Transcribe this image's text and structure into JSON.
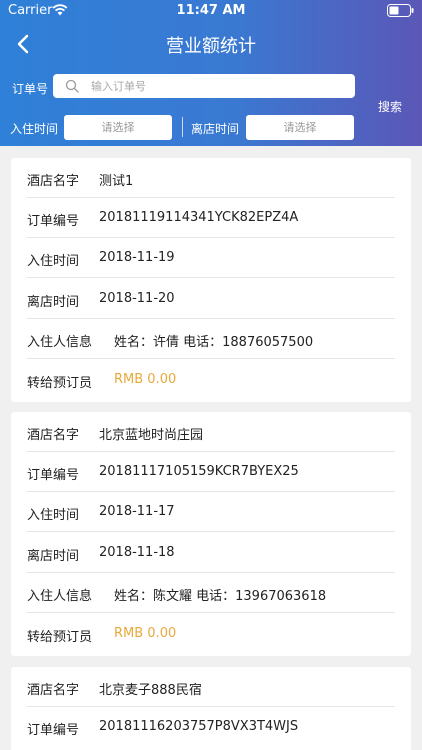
{
  "status": {
    "carrier": "Carrier",
    "time": "11:47 AM"
  },
  "nav": {
    "title": "营业额统计"
  },
  "search": {
    "order_label": "订单号",
    "order_placeholder": "输入订单号",
    "search_label": "搜索",
    "checkin_label": "入住时间",
    "checkout_label": "离店时间",
    "select_placeholder": "请选择"
  },
  "labels": {
    "hotel": "酒店名字",
    "order_no": "订单编号",
    "checkin": "入住时间",
    "checkout": "离店时间",
    "guest": "入住人信息",
    "transfer": "转给预订员"
  },
  "orders": [
    {
      "hotel": "测试1",
      "order_no": "20181119114341YCK82EPZ4A",
      "checkin": "2018-11-19",
      "checkout": "2018-11-20",
      "guest": "姓名：许倩  电话：18876057500",
      "transfer": "RMB 0.00"
    },
    {
      "hotel": "北京蓝地时尚庄园",
      "order_no": "20181117105159KCR7BYEX25",
      "checkin": "2018-11-17",
      "checkout": "2018-11-18",
      "guest": "姓名：陈文耀  电话：13967063618",
      "transfer": "RMB 0.00"
    },
    {
      "hotel": "北京麦子888民宿",
      "order_no": "20181116203757P8VX3T4WJS"
    }
  ],
  "colors": {
    "header_start": "#2f80d8",
    "header_end": "#5b57b7",
    "amount": "#e8a93a",
    "background": "#f0f0f0"
  }
}
